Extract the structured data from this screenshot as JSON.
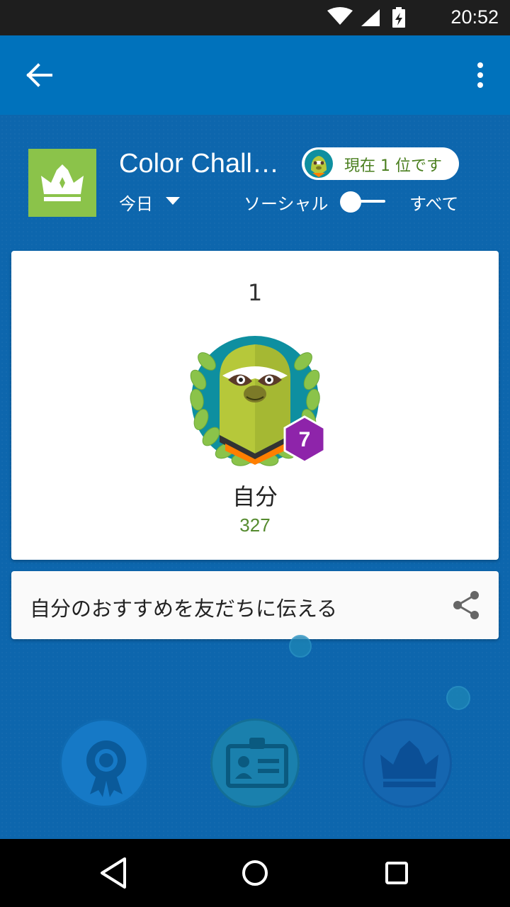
{
  "status_bar": {
    "time": "20:52"
  },
  "header": {
    "game_title": "Color Chall…",
    "rank_status": "現在 1 位です",
    "period": "今日",
    "toggle_left": "ソーシャル",
    "toggle_right": "すべて"
  },
  "leaderboard": {
    "rank": "1",
    "level": "7",
    "player_name": "自分",
    "score": "327"
  },
  "share": {
    "label": "自分のおすすめを友だちに伝える"
  },
  "colors": {
    "app_bar": "#0072bc",
    "background": "#0d66ad",
    "game_icon": "#8bc34a",
    "level_badge": "#8e24aa",
    "score": "#558b2f"
  },
  "icons": [
    "back-arrow-icon",
    "more-vert-icon",
    "crown-icon",
    "share-icon",
    "achievements-icon",
    "player-card-icon",
    "leaderboard-crown-icon",
    "nav-back-icon",
    "nav-home-icon",
    "nav-recents-icon"
  ]
}
